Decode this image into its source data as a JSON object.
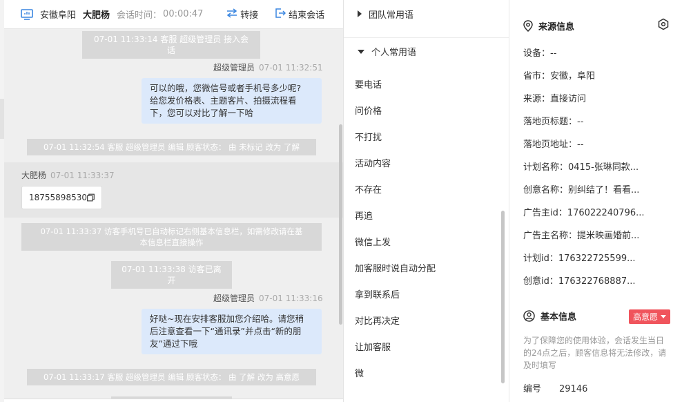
{
  "header": {
    "region": "安徽阜阳",
    "visitor_name": "大肥杨",
    "duration_label": "会话时间：",
    "duration": "00:00:47",
    "transfer_label": "转接",
    "end_label": "结束会话"
  },
  "messages": {
    "sys1": "07-01 11:33:14 客服 超级管理员 接入会话",
    "agent1_name": "超级管理员",
    "agent1_time": "07-01 11:32:51",
    "agent1_lines": [
      "可以的哦，您微信号或者手机号多少呢?",
      "给您发价格表、主题客片、拍摄流程看",
      "下，您可以对比了解一下哈"
    ],
    "sys2": "07-01 11:32:54 客服 超级管理员 编辑 顾客状态： 由 未标记 改为 了解",
    "visitor_name": "大肥杨",
    "visitor_time": "07-01 11:33:37",
    "visitor_phone": "18755898530",
    "sys3_line1": "07-01 11:33:37 访客手机号已自动标记右侧基本信息栏，如需修改请在基",
    "sys3_line2": "本信息栏直接操作",
    "sys4": "07-01 11:33:38 访客已离开",
    "agent2_name": "超级管理员",
    "agent2_time": "07-01 11:33:16",
    "agent2_lines": [
      "好哒~现在安排客服加您介绍哈。请您稍",
      "后注意查看一下“通讯录”并点击“新的朋",
      "友”通过下哦"
    ],
    "sys5": "07-01 11:33:17 客服 超级管理员 编辑 顾客状态： 由 了解 改为 高意愿"
  },
  "phrases": {
    "team_group": "团队常用语",
    "personal_group": "个人常用语",
    "items": [
      "要电话",
      "问价格",
      "不打扰",
      "活动内容",
      "不存在",
      "再追",
      "微信上发",
      "加客服时说自动分配",
      "拿到联系后",
      "对比再决定",
      "让加客服",
      "微"
    ]
  },
  "source_info": {
    "title": "来源信息",
    "rows": [
      "设备：--",
      "省市：安徽，阜阳",
      "来源：直接访问",
      "落地页标题：--",
      "落地页地址：--",
      "计划名称：0415-张琳同款...",
      "创意名称：别纠结了！看看...",
      "广告主id：176022240796...",
      "广告主名称：提米映画婚前...",
      "计划id：176322725599...",
      "创意id：176322768887..."
    ]
  },
  "basic_info": {
    "title": "基本信息",
    "intent_badge": "高意愿",
    "notice": "为了保障您的使用体验，会话发生当日的24点之后，顾客信息将无法修改，请及时填写",
    "id_label": "编号",
    "id_value": "29146"
  },
  "colors": {
    "accent": "#3a86e0",
    "bubble": "#dce9fb",
    "badge": "#f0545c",
    "system_msg": "#d8d8d8"
  }
}
